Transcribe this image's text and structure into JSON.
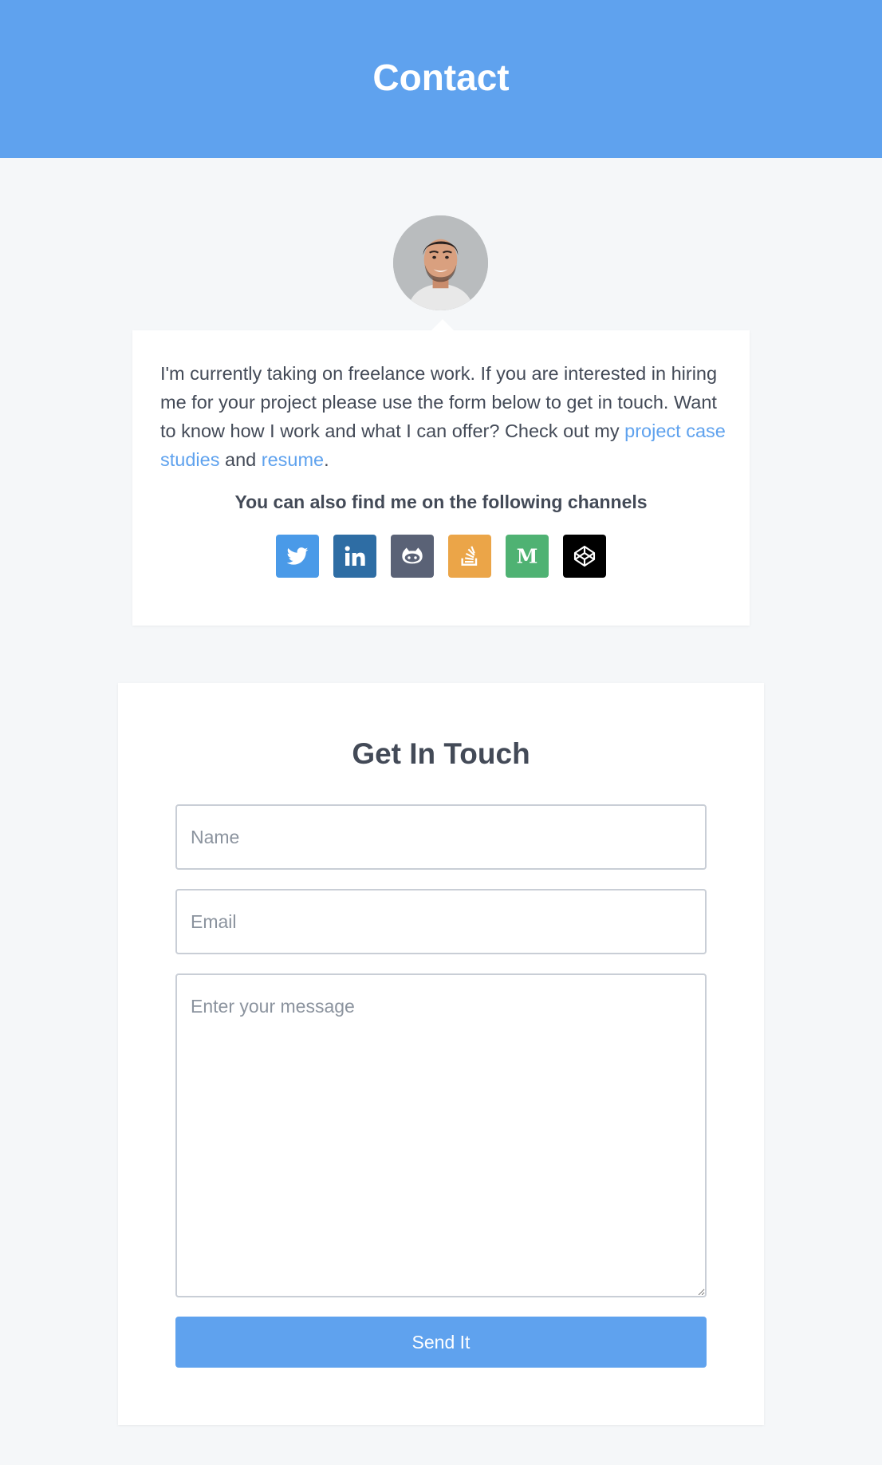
{
  "header": {
    "title": "Contact"
  },
  "intro": {
    "text_before": "I'm currently taking on freelance work. If you are interested in hiring me for your project please use the form below to get in touch. Want to know how I work and what I can offer? Check out my ",
    "link_case_studies": "project case studies",
    "text_and": " and ",
    "link_resume": "resume",
    "text_end": ".",
    "channels_title": "You can also find me on the following channels",
    "socials": [
      {
        "name": "twitter",
        "icon": "twitter-icon",
        "color": "#4a9ae8"
      },
      {
        "name": "linkedin",
        "icon": "linkedin-icon",
        "color": "#2e6da4"
      },
      {
        "name": "github",
        "icon": "github-icon",
        "color": "#5a6276"
      },
      {
        "name": "stackoverflow",
        "icon": "stackoverflow-icon",
        "color": "#eba548"
      },
      {
        "name": "medium",
        "icon": "medium-icon",
        "color": "#4fb273"
      },
      {
        "name": "codepen",
        "icon": "codepen-icon",
        "color": "#000000"
      }
    ]
  },
  "form": {
    "title": "Get In Touch",
    "name_placeholder": "Name",
    "email_placeholder": "Email",
    "message_placeholder": "Enter your message",
    "submit_label": "Send It"
  },
  "colors": {
    "accent": "#5fa2ee",
    "text": "#434a57",
    "background": "#f5f7f9"
  }
}
